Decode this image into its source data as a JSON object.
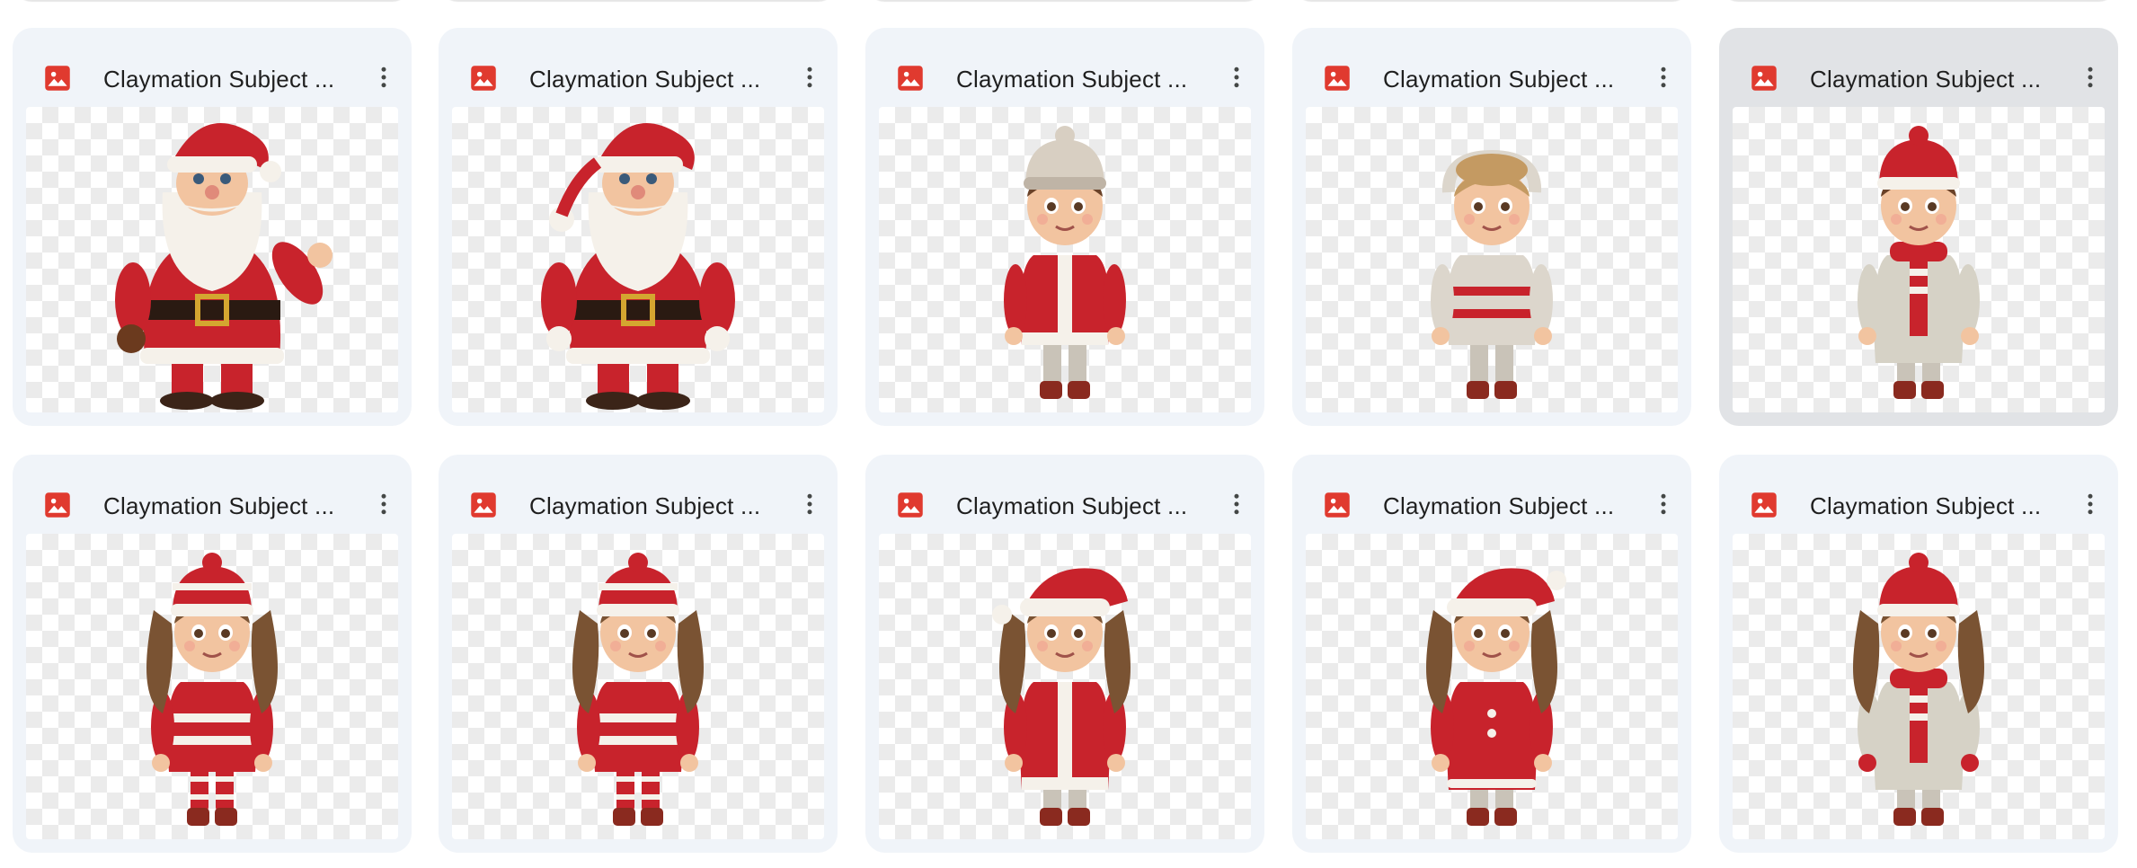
{
  "file_icon": "image-file-icon",
  "more_icon": "more-vert-icon",
  "colors": {
    "icon_red": "#e03a2f",
    "card_bg": "#f0f4f9",
    "card_selected_bg": "#e1e3e6",
    "text": "#1f1f1f"
  },
  "files": [
    {
      "title": "Claymation Subject ...",
      "subject": "santa-waving",
      "selected": false
    },
    {
      "title": "Claymation Subject ...",
      "subject": "santa-standing",
      "selected": false
    },
    {
      "title": "Claymation Subject ...",
      "subject": "boy-knit-hat",
      "selected": false
    },
    {
      "title": "Claymation Subject ...",
      "subject": "boy-onesie",
      "selected": false
    },
    {
      "title": "Claymation Subject ...",
      "subject": "boy-parka",
      "selected": true
    },
    {
      "title": "Claymation Subject ...",
      "subject": "girl-hoodie",
      "selected": false
    },
    {
      "title": "Claymation Subject ...",
      "subject": "girl-sweater",
      "selected": false
    },
    {
      "title": "Claymation Subject ...",
      "subject": "girl-santa-hat-coat",
      "selected": false
    },
    {
      "title": "Claymation Subject ...",
      "subject": "girl-red-dress",
      "selected": false
    },
    {
      "title": "Claymation Subject ...",
      "subject": "girl-grey-coat",
      "selected": false
    }
  ]
}
